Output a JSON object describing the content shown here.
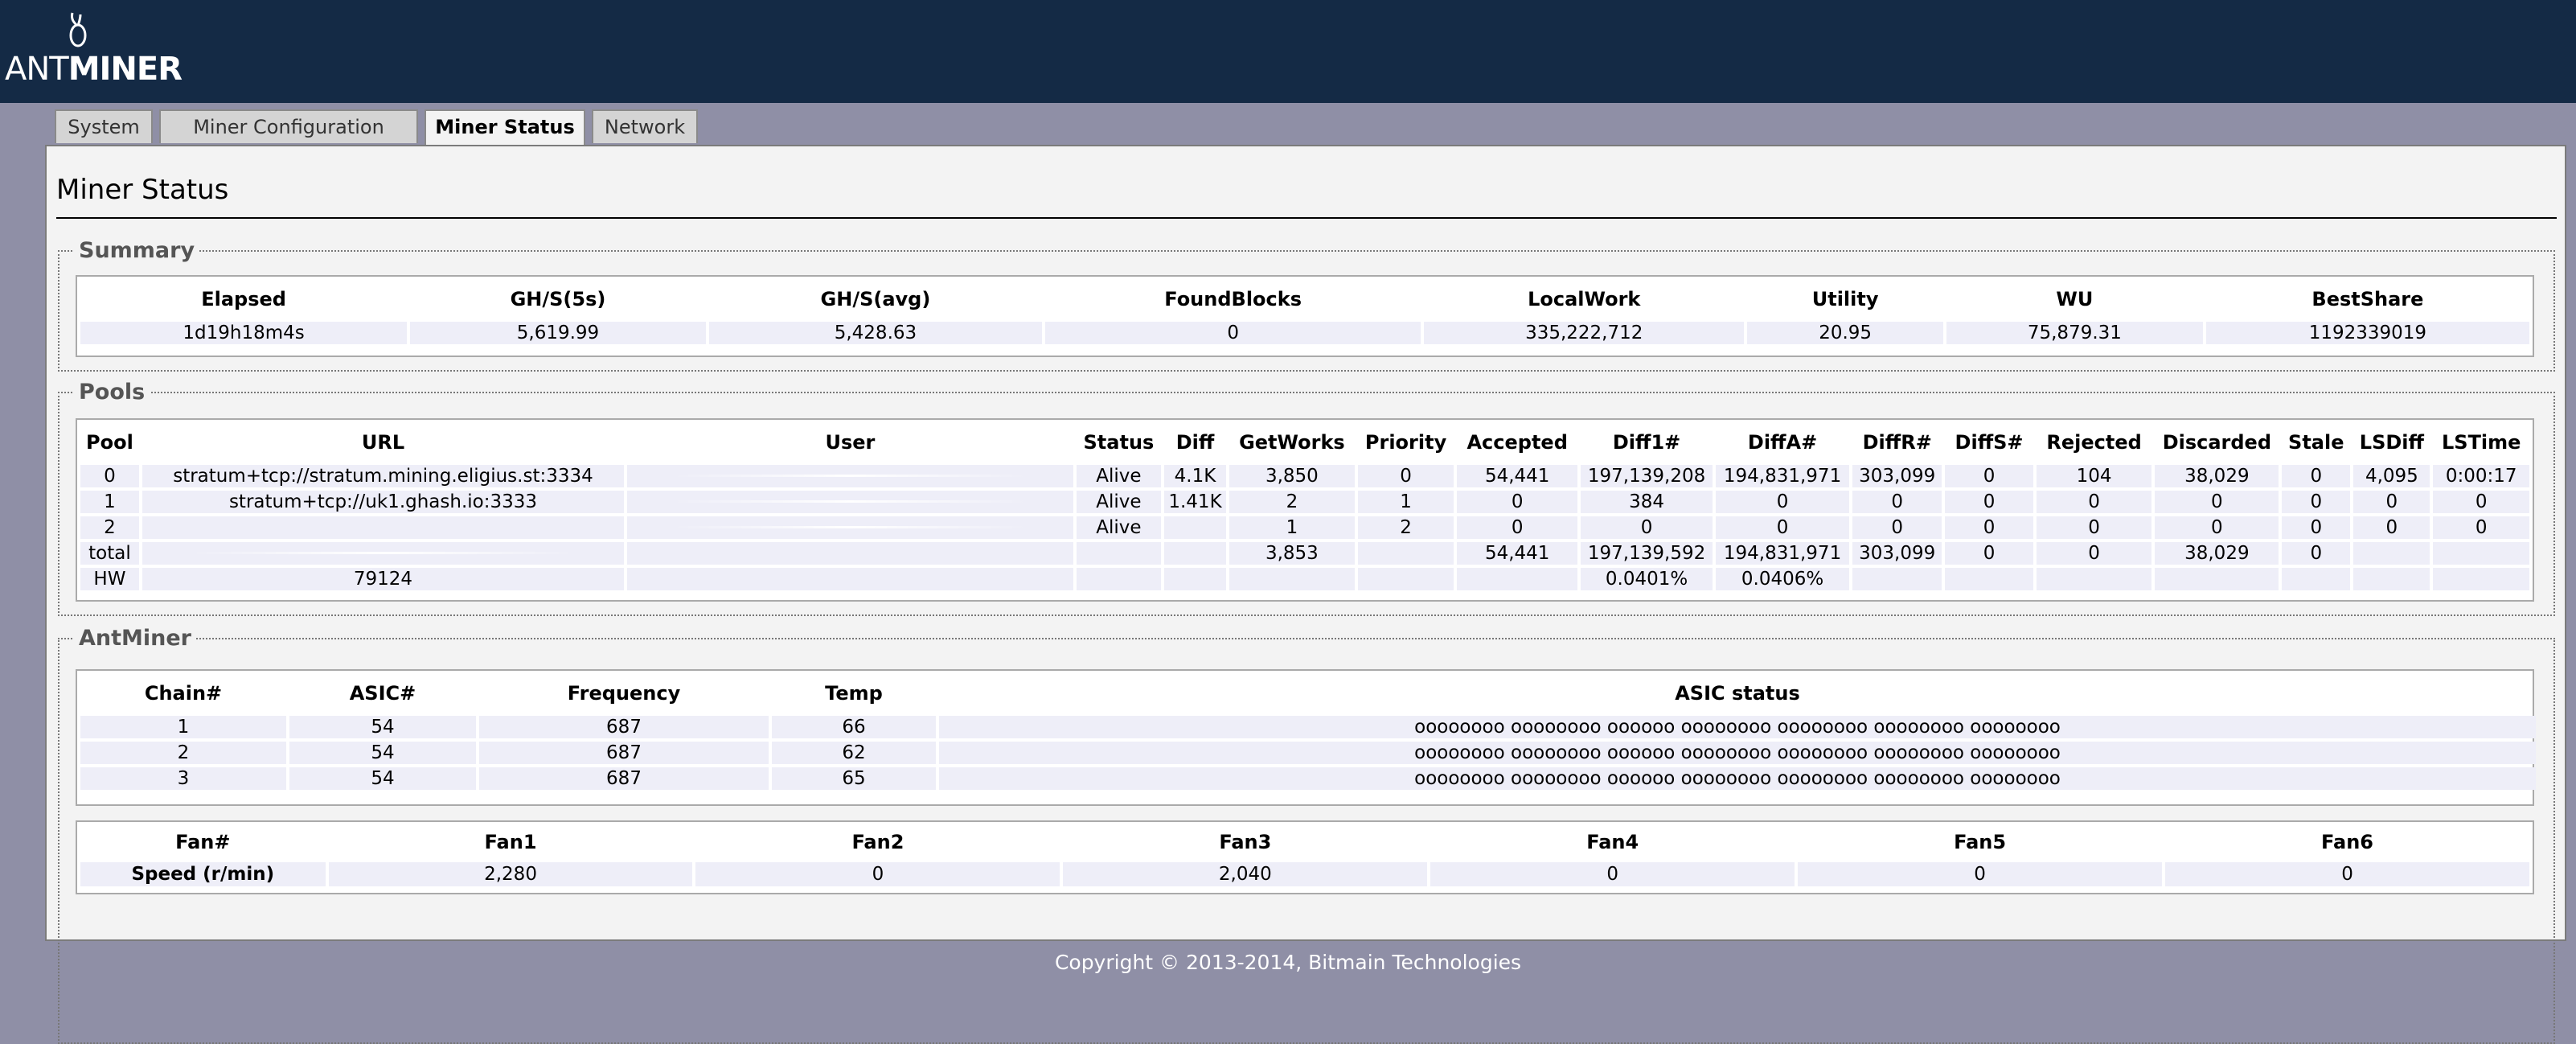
{
  "header": {
    "logo_text_left": "ANT",
    "logo_text_right": "MINER"
  },
  "tabs": [
    {
      "label": "System"
    },
    {
      "label": "Miner Configuration"
    },
    {
      "label": "Miner Status"
    },
    {
      "label": "Network"
    }
  ],
  "page_title": "Miner Status",
  "summary": {
    "legend": "Summary",
    "headers": [
      "Elapsed",
      "GH/S(5s)",
      "GH/S(avg)",
      "FoundBlocks",
      "LocalWork",
      "Utility",
      "WU",
      "BestShare"
    ],
    "values": [
      "1d19h18m4s",
      "5,619.99",
      "5,428.63",
      "0",
      "335,222,712",
      "20.95",
      "75,879.31",
      "1192339019"
    ]
  },
  "pools": {
    "legend": "Pools",
    "headers": [
      "Pool",
      "URL",
      "User",
      "Status",
      "Diff",
      "GetWorks",
      "Priority",
      "Accepted",
      "Diff1#",
      "DiffA#",
      "DiffR#",
      "DiffS#",
      "Rejected",
      "Discarded",
      "Stale",
      "LSDiff",
      "LSTime"
    ],
    "rows": [
      [
        "0",
        "stratum+tcp://stratum.mining.eligius.st:3334",
        "",
        "Alive",
        "4.1K",
        "3,850",
        "0",
        "54,441",
        "197,139,208",
        "194,831,971",
        "303,099",
        "0",
        "104",
        "38,029",
        "0",
        "4,095",
        "0:00:17"
      ],
      [
        "1",
        "stratum+tcp://uk1.ghash.io:3333",
        "",
        "Alive",
        "1.41K",
        "2",
        "1",
        "0",
        "384",
        "0",
        "0",
        "0",
        "0",
        "0",
        "0",
        "0",
        "0"
      ],
      [
        "2",
        "",
        "",
        "Alive",
        "",
        "1",
        "2",
        "0",
        "0",
        "0",
        "0",
        "0",
        "0",
        "0",
        "0",
        "0",
        "0"
      ],
      [
        "total",
        "",
        "",
        "",
        "",
        "3,853",
        "",
        "54,441",
        "197,139,592",
        "194,831,971",
        "303,099",
        "0",
        "0",
        "38,029",
        "0",
        "",
        ""
      ],
      [
        "HW",
        "79124",
        "",
        "",
        "",
        "",
        "",
        "",
        "0.0401%",
        "0.0406%",
        "",
        "",
        "",
        "",
        "",
        "",
        ""
      ]
    ]
  },
  "antminer": {
    "legend": "AntMiner",
    "chain_headers": [
      "Chain#",
      "ASIC#",
      "Frequency",
      "Temp",
      "ASIC status"
    ],
    "chains": [
      [
        "1",
        "54",
        "687",
        "66",
        "oooooooo oooooooo oooooo oooooooo oooooooo oooooooo oooooooo"
      ],
      [
        "2",
        "54",
        "687",
        "62",
        "oooooooo oooooooo oooooo oooooooo oooooooo oooooooo oooooooo"
      ],
      [
        "3",
        "54",
        "687",
        "65",
        "oooooooo oooooooo oooooo oooooooo oooooooo oooooooo oooooooo"
      ]
    ],
    "fan_headers": [
      "Fan#",
      "Fan1",
      "Fan2",
      "Fan3",
      "Fan4",
      "Fan5",
      "Fan6"
    ],
    "fan_row_label": "Speed (r/min)",
    "fan_speeds": [
      "2,280",
      "0",
      "2,040",
      "0",
      "0",
      "0"
    ]
  },
  "footer": "Copyright © 2013-2014, Bitmain Technologies",
  "colors": {
    "header_bg": "#142a45",
    "page_bg": "#8f8fa6",
    "cell_bg": "#eeeef8"
  }
}
